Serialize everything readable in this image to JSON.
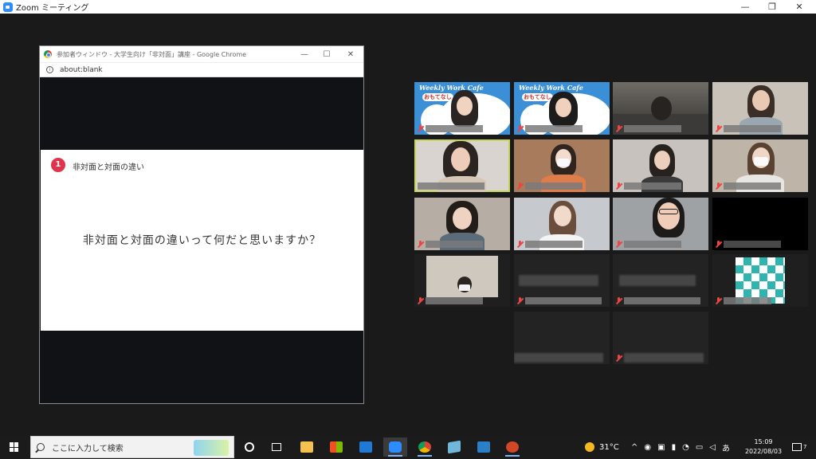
{
  "zoom": {
    "title": "Zoom ミーティング"
  },
  "window_controls": {
    "minimize": "—",
    "maximize": "❐",
    "close": "✕"
  },
  "chrome": {
    "title": "参加者ウィンドウ - 大学生向け「非対面」講座 - Google Chrome",
    "address": "about:blank",
    "controls": {
      "minimize": "—",
      "maximize": "☐",
      "close": "✕"
    }
  },
  "slide": {
    "number": "1",
    "heading": "非対面と対面の違い",
    "question": "非対面と対面の違いって何だと思いますか？"
  },
  "gallery": {
    "cafe_title": "Weekly Work Cafe",
    "cafe_tag": "おもてなし"
  },
  "taskbar": {
    "search_placeholder": "ここに入力して検索",
    "weather": "31°C",
    "ime": "あ",
    "time": "15:09",
    "date": "2022/08/03",
    "notifications": "7"
  },
  "colors": {
    "zoom_blue": "#2d8cff",
    "slide_badge": "#e0344d",
    "active_speaker": "#c9d65a",
    "taskbar": "#1b1b1b"
  }
}
